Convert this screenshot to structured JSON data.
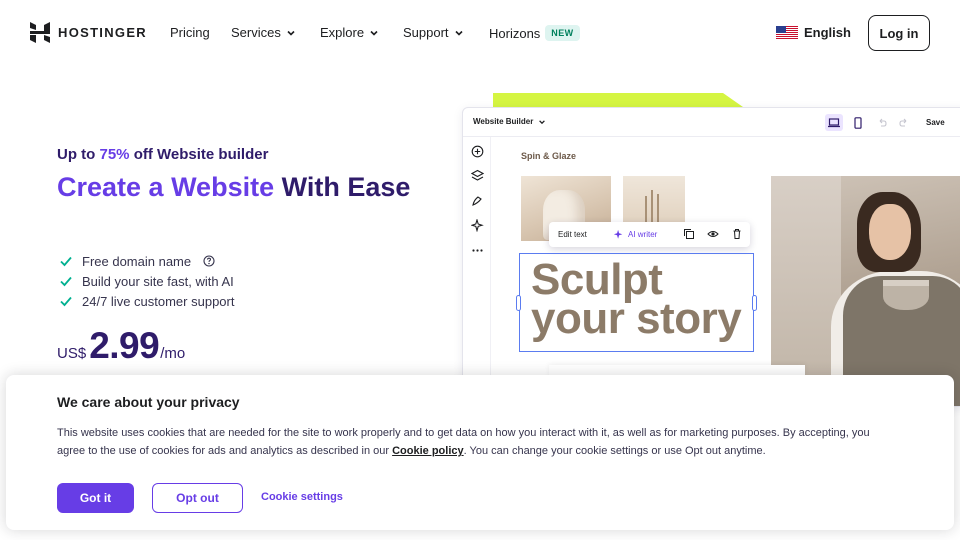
{
  "nav": {
    "brand": "HOSTINGER",
    "items": [
      {
        "label": "Pricing"
      },
      {
        "label": "Services"
      },
      {
        "label": "Explore"
      },
      {
        "label": "Support"
      },
      {
        "label": "Horizons",
        "badge": "NEW"
      }
    ],
    "language": "English",
    "login": "Log in"
  },
  "hero": {
    "eyebrow_prefix": "Up to ",
    "eyebrow_pct": "75%",
    "eyebrow_suffix": " off Website builder",
    "title_accent": "Create a Website",
    "title_rest": " With Ease",
    "features": [
      "Free domain name",
      "Build your site fast, with AI",
      "24/7 live customer support"
    ],
    "price": {
      "currency": "US$",
      "amount": "2.99",
      "period": "/mo"
    }
  },
  "builder": {
    "title": "Website Builder",
    "save": "Save",
    "site_name": "Spin & Glaze",
    "toolbar": {
      "edit": "Edit text",
      "ai": "AI writer"
    },
    "headline_line1": "Sculpt",
    "headline_line2": "your story"
  },
  "cookie": {
    "title": "We care about your privacy",
    "text_before": "This website uses cookies that are needed for the site to work properly and to get data on how you interact with it, as well as for marketing purposes. By accepting, you agree to the use of cookies for ads and analytics as described in our ",
    "link": "Cookie policy",
    "text_after": ". You can change your cookie settings or use Opt out anytime.",
    "accept": "Got it",
    "optout": "Opt out",
    "settings": "Cookie settings"
  },
  "colors": {
    "brand": "#673de6",
    "heading": "#2f1c6a",
    "check": "#00b090",
    "lime": "#d5f542"
  }
}
